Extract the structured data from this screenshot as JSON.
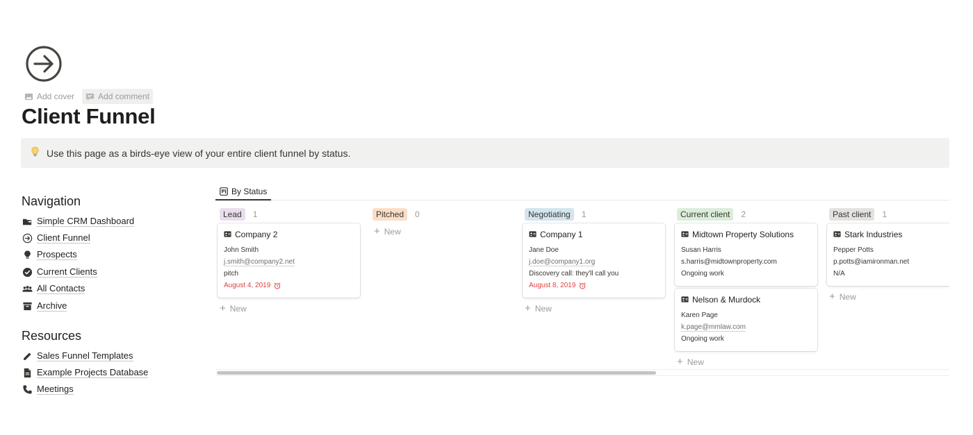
{
  "page": {
    "icon": "arrow-circle-right-icon",
    "actions": [
      {
        "label": "Add cover",
        "icon": "image-icon"
      },
      {
        "label": "Add comment",
        "icon": "comment-icon"
      }
    ],
    "title": "Client Funnel",
    "callout": {
      "icon": "lightbulb-icon",
      "text": "Use this page as a birds-eye view of your entire client funnel by status."
    }
  },
  "navigation": {
    "heading": "Navigation",
    "items": [
      {
        "label": "Simple CRM Dashboard",
        "icon": "folder-arrow-icon"
      },
      {
        "label": "Client Funnel",
        "icon": "arrow-circle-right-icon"
      },
      {
        "label": "Prospects",
        "icon": "lightbulb-icon"
      },
      {
        "label": "Current Clients",
        "icon": "check-circle-icon"
      },
      {
        "label": "All Contacts",
        "icon": "people-icon"
      },
      {
        "label": "Archive",
        "icon": "archive-icon"
      }
    ]
  },
  "resources": {
    "heading": "Resources",
    "items": [
      {
        "label": "Sales Funnel Templates",
        "icon": "pencil-icon"
      },
      {
        "label": "Example Projects Database",
        "icon": "document-icon"
      },
      {
        "label": "Meetings",
        "icon": "phone-icon"
      }
    ]
  },
  "board": {
    "tab_label": "By Status",
    "new_label": "New",
    "columns": [
      {
        "label": "Lead",
        "count": "1",
        "color": "#e8deee",
        "cards": [
          {
            "title": "Company 2",
            "name": "John Smith",
            "email": "j.smith@company2.net",
            "note": "pitch",
            "date": "August 4, 2019"
          }
        ]
      },
      {
        "label": "Pitched",
        "count": "0",
        "color": "#fadec9",
        "cards": []
      },
      {
        "label": "Negotiating",
        "count": "1",
        "color": "#d3e5ef",
        "cards": [
          {
            "title": "Company 1",
            "name": "Jane Doe",
            "email": "j.doe@company1.org",
            "note": "Discovery call: they'll call you",
            "date": "August 8, 2019"
          }
        ]
      },
      {
        "label": "Current client",
        "count": "2",
        "color": "#dbeddb",
        "cards": [
          {
            "title": "Midtown Property Solutions",
            "name": "Susan Harris",
            "email": "s.harris@midtownproperty.com",
            "note": "Ongoing work"
          },
          {
            "title": "Nelson & Murdock",
            "name": "Karen Page",
            "email": "k.page@mmlaw.com",
            "note": "Ongoing work"
          }
        ]
      },
      {
        "label": "Past client",
        "count": "1",
        "color": "#e3e2e0",
        "cards": [
          {
            "title": "Stark Industries",
            "name": "Pepper Potts",
            "email": "p.potts@iamironman.net",
            "note": "N/A"
          }
        ]
      }
    ]
  }
}
